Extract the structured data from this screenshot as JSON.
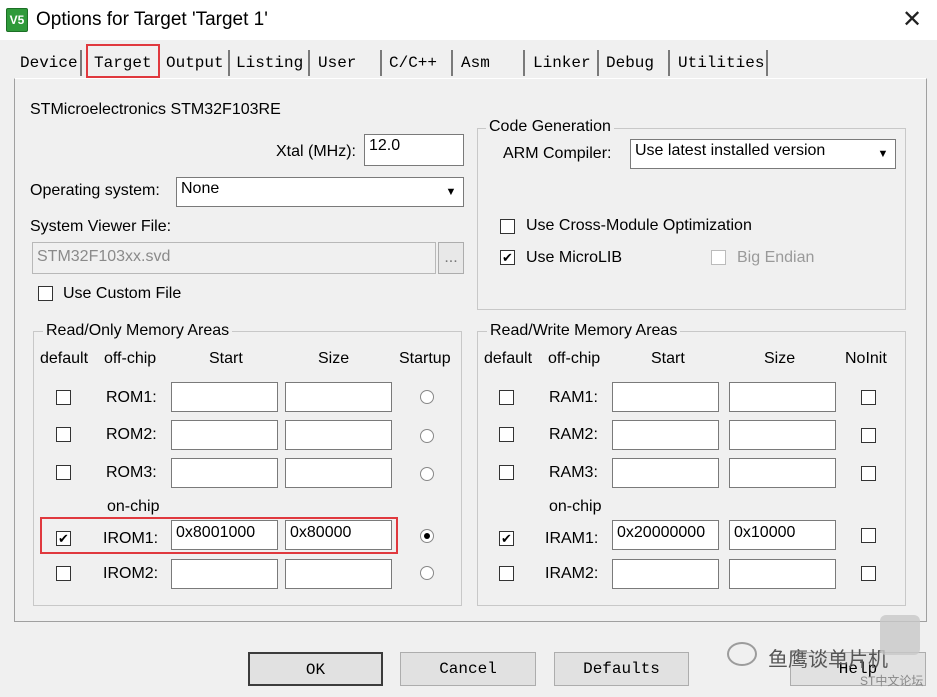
{
  "window": {
    "title": "Options for Target 'Target 1'",
    "app_icon_text": "V5"
  },
  "tabs": [
    "Device",
    "Target",
    "Output",
    "Listing",
    "User",
    "C/C++",
    "Asm",
    "Linker",
    "Debug",
    "Utilities"
  ],
  "device": "STMicroelectronics STM32F103RE",
  "xtal": {
    "label": "Xtal (MHz):",
    "value": "12.0"
  },
  "os": {
    "label": "Operating system:",
    "value": "None"
  },
  "svf": {
    "label": "System Viewer File:",
    "value": "STM32F103xx.svd",
    "browse": "...",
    "custom_label": "Use Custom File"
  },
  "codegen": {
    "title": "Code Generation",
    "compiler_label": "ARM Compiler:",
    "compiler_value": "Use latest installed version",
    "cross_module": "Use Cross-Module Optimization",
    "microlib": "Use MicroLIB",
    "big_endian": "Big Endian"
  },
  "rom": {
    "title": "Read/Only Memory Areas",
    "headers": {
      "default": "default",
      "offchip": "off-chip",
      "start": "Start",
      "size": "Size",
      "startup": "Startup"
    },
    "onchip_label": "on-chip",
    "rows": [
      {
        "label": "ROM1:",
        "start": "",
        "size": "",
        "checked": false,
        "startup": false
      },
      {
        "label": "ROM2:",
        "start": "",
        "size": "",
        "checked": false,
        "startup": false
      },
      {
        "label": "ROM3:",
        "start": "",
        "size": "",
        "checked": false,
        "startup": false
      },
      {
        "label": "IROM1:",
        "start": "0x8001000",
        "size": "0x80000",
        "checked": true,
        "startup": true
      },
      {
        "label": "IROM2:",
        "start": "",
        "size": "",
        "checked": false,
        "startup": false
      }
    ]
  },
  "ram": {
    "title": "Read/Write Memory Areas",
    "headers": {
      "default": "default",
      "offchip": "off-chip",
      "start": "Start",
      "size": "Size",
      "noinit": "NoInit"
    },
    "onchip_label": "on-chip",
    "rows": [
      {
        "label": "RAM1:",
        "start": "",
        "size": "",
        "checked": false,
        "noinit": false
      },
      {
        "label": "RAM2:",
        "start": "",
        "size": "",
        "checked": false,
        "noinit": false
      },
      {
        "label": "RAM3:",
        "start": "",
        "size": "",
        "checked": false,
        "noinit": false
      },
      {
        "label": "IRAM1:",
        "start": "0x20000000",
        "size": "0x10000",
        "checked": true,
        "noinit": false
      },
      {
        "label": "IRAM2:",
        "start": "",
        "size": "",
        "checked": false,
        "noinit": false
      }
    ]
  },
  "buttons": {
    "ok": "OK",
    "cancel": "Cancel",
    "defaults": "Defaults",
    "help": "Help"
  },
  "watermark": {
    "channel": "鱼鹰谈单片机",
    "forum": "ST中文论坛"
  },
  "colors": {
    "highlight": "#e0393e",
    "check_mark": "✔"
  }
}
